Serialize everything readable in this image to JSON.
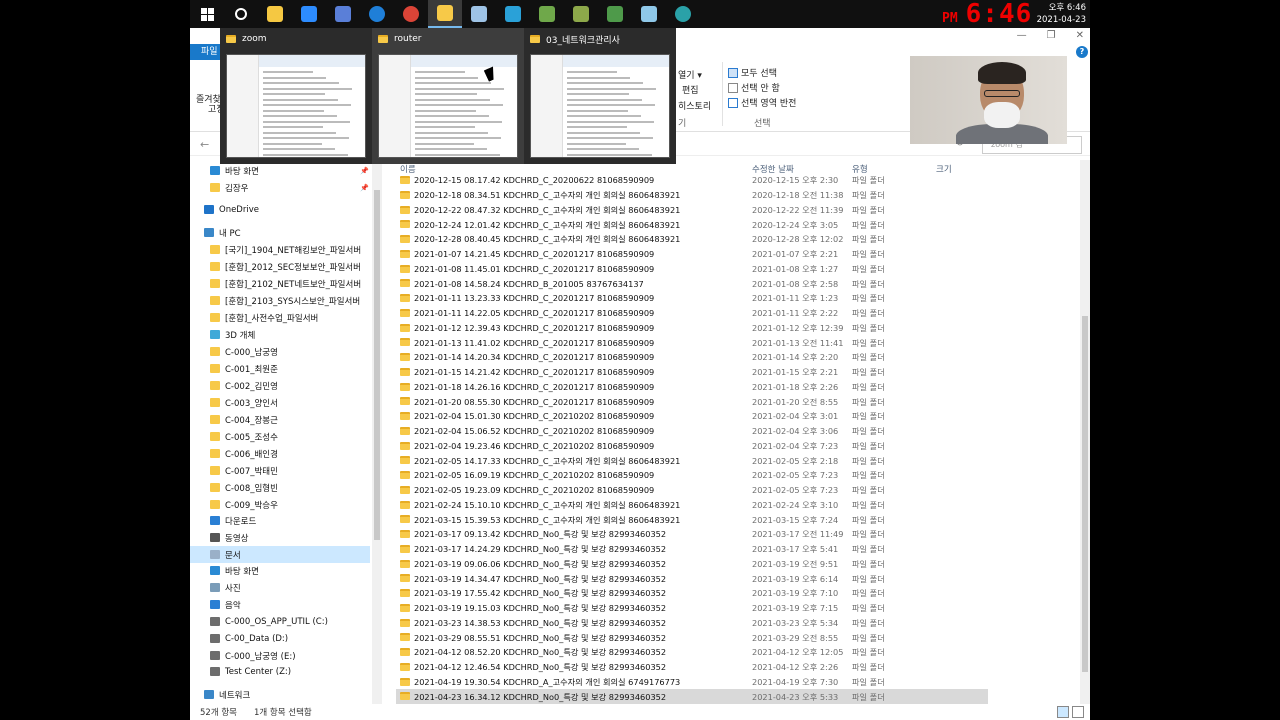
{
  "taskbar": {
    "icons": [
      "windows-start",
      "search",
      "pen-app",
      "zoom-app",
      "network-app",
      "internet-explorer",
      "chrome",
      "file-explorer",
      "cloud-app",
      "window-app",
      "terminal-app",
      "terminal-app-2",
      "terminal-app-3",
      "tablet-app",
      "edge"
    ],
    "overlay_clock_pm": "PM",
    "overlay_clock_time": "6:46",
    "system_time": "오후 6:46",
    "system_date": "2021-04-23"
  },
  "ribbon": {
    "file_tab": "파일",
    "left_labels": [
      "즐겨찾",
      "고정"
    ],
    "open_label": "열기 ▾",
    "edit_label": "편집",
    "history_label": "히스토리",
    "open_group": "기",
    "select_all": "모두 선택",
    "select_none": "선택 안 함",
    "invert_selection": "선택 영역 반전",
    "select_group": "선택"
  },
  "thumbnails": [
    {
      "title": "zoom"
    },
    {
      "title": "router"
    },
    {
      "title": "03_네트워크관리사"
    }
  ],
  "address": {
    "search_placeholder": "zoom 검"
  },
  "nav": [
    {
      "label": "바탕 화면",
      "icon": "desktop-icon",
      "color": "#2a8ad4",
      "pin": true
    },
    {
      "label": "김장우",
      "icon": "user-folder-icon",
      "color": "#f7c948",
      "pin": true
    },
    {
      "label": "OneDrive",
      "icon": "onedrive-icon",
      "color": "#1e73c8"
    },
    {
      "label": "내 PC",
      "icon": "pc-icon",
      "color": "#3a87c8"
    },
    {
      "label": "[국기]_1904_NET해킹보안_파일서버",
      "icon": "folder-icon",
      "color": "#f7c948"
    },
    {
      "label": "[훈합]_2012_SEC정보보안_파일서버",
      "icon": "folder-icon",
      "color": "#f7c948"
    },
    {
      "label": "[훈합]_2102_NET네트보안_파일서버",
      "icon": "folder-icon",
      "color": "#f7c948"
    },
    {
      "label": "[훈합]_2103_SYS시스보안_파일서버",
      "icon": "folder-icon",
      "color": "#f7c948"
    },
    {
      "label": "[훈합]_사전수업_파일서버",
      "icon": "folder-icon",
      "color": "#f7c948"
    },
    {
      "label": "3D 개체",
      "icon": "3d-objects-icon",
      "color": "#3fa9d8"
    },
    {
      "label": "C-000_남궁영",
      "icon": "user-folder-icon",
      "color": "#f7c948"
    },
    {
      "label": "C-001_최원준",
      "icon": "user-folder-icon",
      "color": "#f7c948"
    },
    {
      "label": "C-002_김민영",
      "icon": "user-folder-icon",
      "color": "#f7c948"
    },
    {
      "label": "C-003_양인서",
      "icon": "user-folder-icon",
      "color": "#f7c948"
    },
    {
      "label": "C-004_장봉근",
      "icon": "user-folder-icon",
      "color": "#f7c948"
    },
    {
      "label": "C-005_조성수",
      "icon": "user-folder-icon",
      "color": "#f7c948"
    },
    {
      "label": "C-006_배인경",
      "icon": "user-folder-icon",
      "color": "#f7c948"
    },
    {
      "label": "C-007_박태민",
      "icon": "user-folder-icon",
      "color": "#f7c948"
    },
    {
      "label": "C-008_임형빈",
      "icon": "user-folder-icon",
      "color": "#f7c948"
    },
    {
      "label": "C-009_박승우",
      "icon": "user-folder-icon",
      "color": "#f7c948"
    },
    {
      "label": "다운로드",
      "icon": "download-icon",
      "color": "#2a7fd4"
    },
    {
      "label": "동영상",
      "icon": "video-icon",
      "color": "#555555"
    },
    {
      "label": "문서",
      "icon": "documents-icon",
      "color": "#9ab0c8",
      "selected": true
    },
    {
      "label": "바탕 화면",
      "icon": "desktop-icon",
      "color": "#2a8ad4"
    },
    {
      "label": "사진",
      "icon": "pictures-icon",
      "color": "#7a9cb8"
    },
    {
      "label": "음악",
      "icon": "music-icon",
      "color": "#2a7fd4"
    },
    {
      "label": "C-000_OS_APP_UTIL (C:)",
      "icon": "drive-icon",
      "color": "#6d6d6d"
    },
    {
      "label": "C-00_Data (D:)",
      "icon": "drive-icon",
      "color": "#6d6d6d"
    },
    {
      "label": "C-000_남궁영 (E:)",
      "icon": "drive-icon",
      "color": "#6d6d6d"
    },
    {
      "label": "Test Center (Z:)",
      "icon": "network-drive-icon",
      "color": "#6d6d6d"
    },
    {
      "label": "네트워크",
      "icon": "network-icon",
      "color": "#3a87c8"
    }
  ],
  "columns": {
    "name": "이름",
    "modified": "수정한 날짜",
    "type": "유형",
    "size": "크기"
  },
  "files": [
    {
      "name": "2020-12-15 08.17.42 KDCHRD_C_20200622 81068590909",
      "date": "2020-12-15 오후 2:30",
      "type": "파일 폴더"
    },
    {
      "name": "2020-12-18 08.34.51 KDCHRD_C_고수자의 개인 회의실 8606483921",
      "date": "2020-12-18 오전 11:38",
      "type": "파일 폴더"
    },
    {
      "name": "2020-12-22 08.47.32 KDCHRD_C_고수자의 개인 회의실 8606483921",
      "date": "2020-12-22 오전 11:39",
      "type": "파일 폴더"
    },
    {
      "name": "2020-12-24 12.01.42 KDCHRD_C_고수자의 개인 회의실 8606483921",
      "date": "2020-12-24 오후 3:05",
      "type": "파일 폴더"
    },
    {
      "name": "2020-12-28 08.40.45 KDCHRD_C_고수자의 개인 회의실 8606483921",
      "date": "2020-12-28 오후 12:02",
      "type": "파일 폴더"
    },
    {
      "name": "2021-01-07 14.21.45 KDCHRD_C_20201217 81068590909",
      "date": "2021-01-07 오후 2:21",
      "type": "파일 폴더"
    },
    {
      "name": "2021-01-08 11.45.01 KDCHRD_C_20201217 81068590909",
      "date": "2021-01-08 오후 1:27",
      "type": "파일 폴더"
    },
    {
      "name": "2021-01-08 14.58.24 KDCHRD_B_201005 83767634137",
      "date": "2021-01-08 오후 2:58",
      "type": "파일 폴더"
    },
    {
      "name": "2021-01-11 13.23.33 KDCHRD_C_20201217 81068590909",
      "date": "2021-01-11 오후 1:23",
      "type": "파일 폴더"
    },
    {
      "name": "2021-01-11 14.22.05 KDCHRD_C_20201217 81068590909",
      "date": "2021-01-11 오후 2:22",
      "type": "파일 폴더"
    },
    {
      "name": "2021-01-12 12.39.43 KDCHRD_C_20201217 81068590909",
      "date": "2021-01-12 오후 12:39",
      "type": "파일 폴더"
    },
    {
      "name": "2021-01-13 11.41.02 KDCHRD_C_20201217 81068590909",
      "date": "2021-01-13 오전 11:41",
      "type": "파일 폴더"
    },
    {
      "name": "2021-01-14 14.20.34 KDCHRD_C_20201217 81068590909",
      "date": "2021-01-14 오후 2:20",
      "type": "파일 폴더"
    },
    {
      "name": "2021-01-15 14.21.42 KDCHRD_C_20201217 81068590909",
      "date": "2021-01-15 오후 2:21",
      "type": "파일 폴더"
    },
    {
      "name": "2021-01-18 14.26.16 KDCHRD_C_20201217 81068590909",
      "date": "2021-01-18 오후 2:26",
      "type": "파일 폴더"
    },
    {
      "name": "2021-01-20 08.55.30 KDCHRD_C_20201217 81068590909",
      "date": "2021-01-20 오전 8:55",
      "type": "파일 폴더"
    },
    {
      "name": "2021-02-04 15.01.30 KDCHRD_C_20210202 81068590909",
      "date": "2021-02-04 오후 3:01",
      "type": "파일 폴더"
    },
    {
      "name": "2021-02-04 15.06.52 KDCHRD_C_20210202 81068590909",
      "date": "2021-02-04 오후 3:06",
      "type": "파일 폴더"
    },
    {
      "name": "2021-02-04 19.23.46 KDCHRD_C_20210202 81068590909",
      "date": "2021-02-04 오후 7:23",
      "type": "파일 폴더"
    },
    {
      "name": "2021-02-05 14.17.33 KDCHRD_C_고수자의 개인 회의실 8606483921",
      "date": "2021-02-05 오후 2:18",
      "type": "파일 폴더"
    },
    {
      "name": "2021-02-05 16.09.19 KDCHRD_C_20210202 81068590909",
      "date": "2021-02-05 오후 7:23",
      "type": "파일 폴더"
    },
    {
      "name": "2021-02-05 19.23.09 KDCHRD_C_20210202 81068590909",
      "date": "2021-02-05 오후 7:23",
      "type": "파일 폴더"
    },
    {
      "name": "2021-02-24 15.10.10 KDCHRD_C_고수자의 개인 회의실 8606483921",
      "date": "2021-02-24 오후 3:10",
      "type": "파일 폴더"
    },
    {
      "name": "2021-03-15 15.39.53 KDCHRD_C_고수자의 개인 회의실 8606483921",
      "date": "2021-03-15 오후 7:24",
      "type": "파일 폴더"
    },
    {
      "name": "2021-03-17 09.13.42 KDCHRD_No0_특강 및 보강 82993460352",
      "date": "2021-03-17 오전 11:49",
      "type": "파일 폴더"
    },
    {
      "name": "2021-03-17 14.24.29 KDCHRD_No0_특강 및 보강 82993460352",
      "date": "2021-03-17 오후 5:41",
      "type": "파일 폴더"
    },
    {
      "name": "2021-03-19 09.06.06 KDCHRD_No0_특강 및 보강 82993460352",
      "date": "2021-03-19 오전 9:51",
      "type": "파일 폴더"
    },
    {
      "name": "2021-03-19 14.34.47 KDCHRD_No0_특강 및 보강 82993460352",
      "date": "2021-03-19 오후 6:14",
      "type": "파일 폴더"
    },
    {
      "name": "2021-03-19 17.55.42 KDCHRD_No0_특강 및 보강 82993460352",
      "date": "2021-03-19 오후 7:10",
      "type": "파일 폴더"
    },
    {
      "name": "2021-03-19 19.15.03 KDCHRD_No0_특강 및 보강 82993460352",
      "date": "2021-03-19 오후 7:15",
      "type": "파일 폴더"
    },
    {
      "name": "2021-03-23 14.38.53 KDCHRD_No0_특강 및 보강 82993460352",
      "date": "2021-03-23 오후 5:34",
      "type": "파일 폴더"
    },
    {
      "name": "2021-03-29 08.55.51 KDCHRD_No0_특강 및 보강 82993460352",
      "date": "2021-03-29 오전 8:55",
      "type": "파일 폴더"
    },
    {
      "name": "2021-04-12 08.52.20 KDCHRD_No0_특강 및 보강 82993460352",
      "date": "2021-04-12 오후 12:05",
      "type": "파일 폴더"
    },
    {
      "name": "2021-04-12 12.46.54 KDCHRD_No0_특강 및 보강 82993460352",
      "date": "2021-04-12 오후 2:26",
      "type": "파일 폴더"
    },
    {
      "name": "2021-04-19 19.30.54 KDCHRD_A_고수자의 개인 회의실 6749176773",
      "date": "2021-04-19 오후 7:30",
      "type": "파일 폴더"
    },
    {
      "name": "2021-04-23 16.34.12 KDCHRD_No0_특강 및 보강 82993460352",
      "date": "2021-04-23 오후 5:33",
      "type": "파일 폴더",
      "selected": true
    }
  ],
  "status": {
    "item_count": "52개 항목",
    "selected": "1개 항목 선택함"
  }
}
